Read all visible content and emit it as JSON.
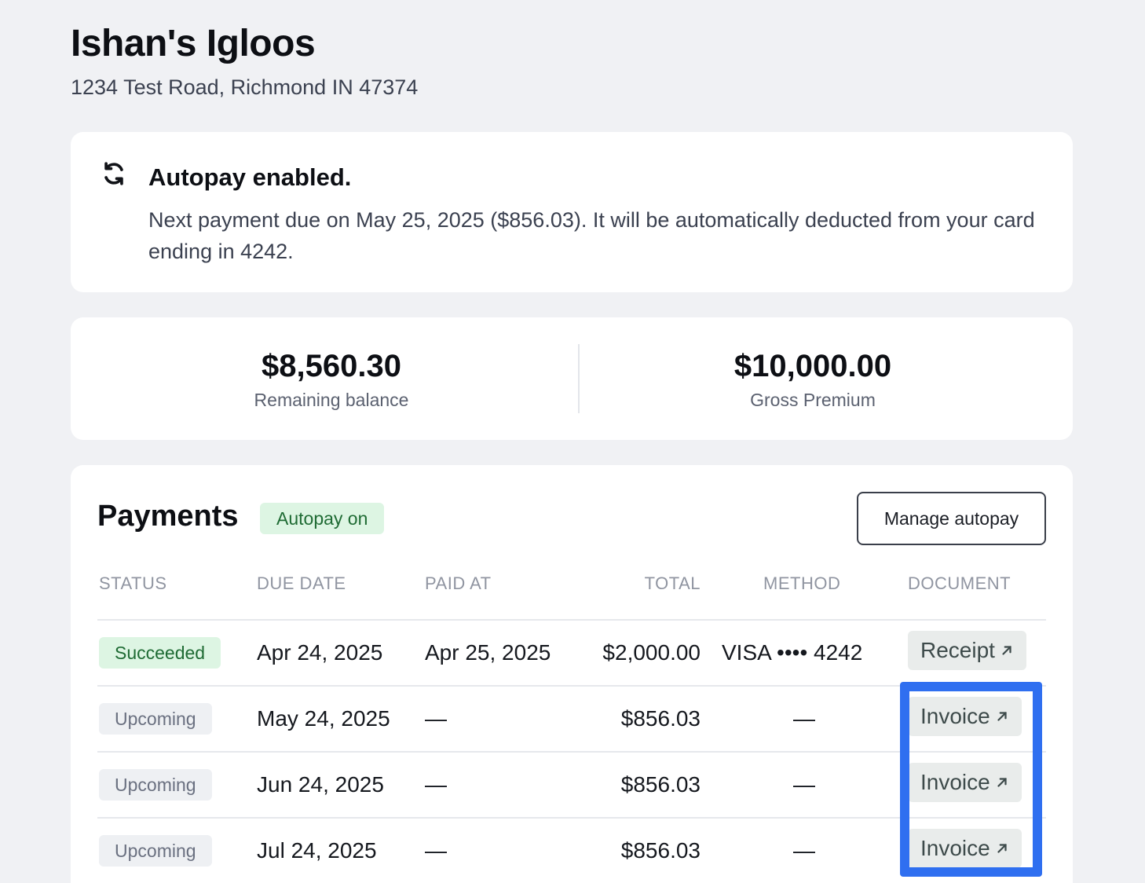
{
  "business": {
    "name": "Ishan's Igloos",
    "address": "1234 Test Road, Richmond IN 47374"
  },
  "autopay_banner": {
    "icon": "refresh-icon",
    "title": "Autopay enabled.",
    "message": "Next payment due on May 25, 2025 ($856.03). It will be automatically deducted from your card ending in 4242."
  },
  "summary": {
    "remaining_balance": {
      "value": "$8,560.30",
      "label": "Remaining balance"
    },
    "gross_premium": {
      "value": "$10,000.00",
      "label": "Gross Premium"
    }
  },
  "payments": {
    "title": "Payments",
    "autopay_pill": "Autopay on",
    "manage_button": "Manage autopay",
    "columns": {
      "status": "STATUS",
      "due_date": "DUE DATE",
      "paid_at": "PAID AT",
      "total": "TOTAL",
      "method": "METHOD",
      "document": "DOCUMENT"
    },
    "rows": [
      {
        "status": "Succeeded",
        "due_date": "Apr 24, 2025",
        "paid_at": "Apr 25, 2025",
        "total": "$2,000.00",
        "method": "VISA •••• 4242",
        "document": "Receipt"
      },
      {
        "status": "Upcoming",
        "due_date": "May 24, 2025",
        "paid_at": "—",
        "total": "$856.03",
        "method": "—",
        "document": "Invoice"
      },
      {
        "status": "Upcoming",
        "due_date": "Jun 24, 2025",
        "paid_at": "—",
        "total": "$856.03",
        "method": "—",
        "document": "Invoice"
      },
      {
        "status": "Upcoming",
        "due_date": "Jul 24, 2025",
        "paid_at": "—",
        "total": "$856.03",
        "method": "—",
        "document": "Invoice"
      }
    ]
  },
  "colors": {
    "background": "#f0f1f4",
    "success_bg": "#ddf5e3",
    "success_text": "#1f6b34",
    "highlight": "#2f6ff0"
  }
}
